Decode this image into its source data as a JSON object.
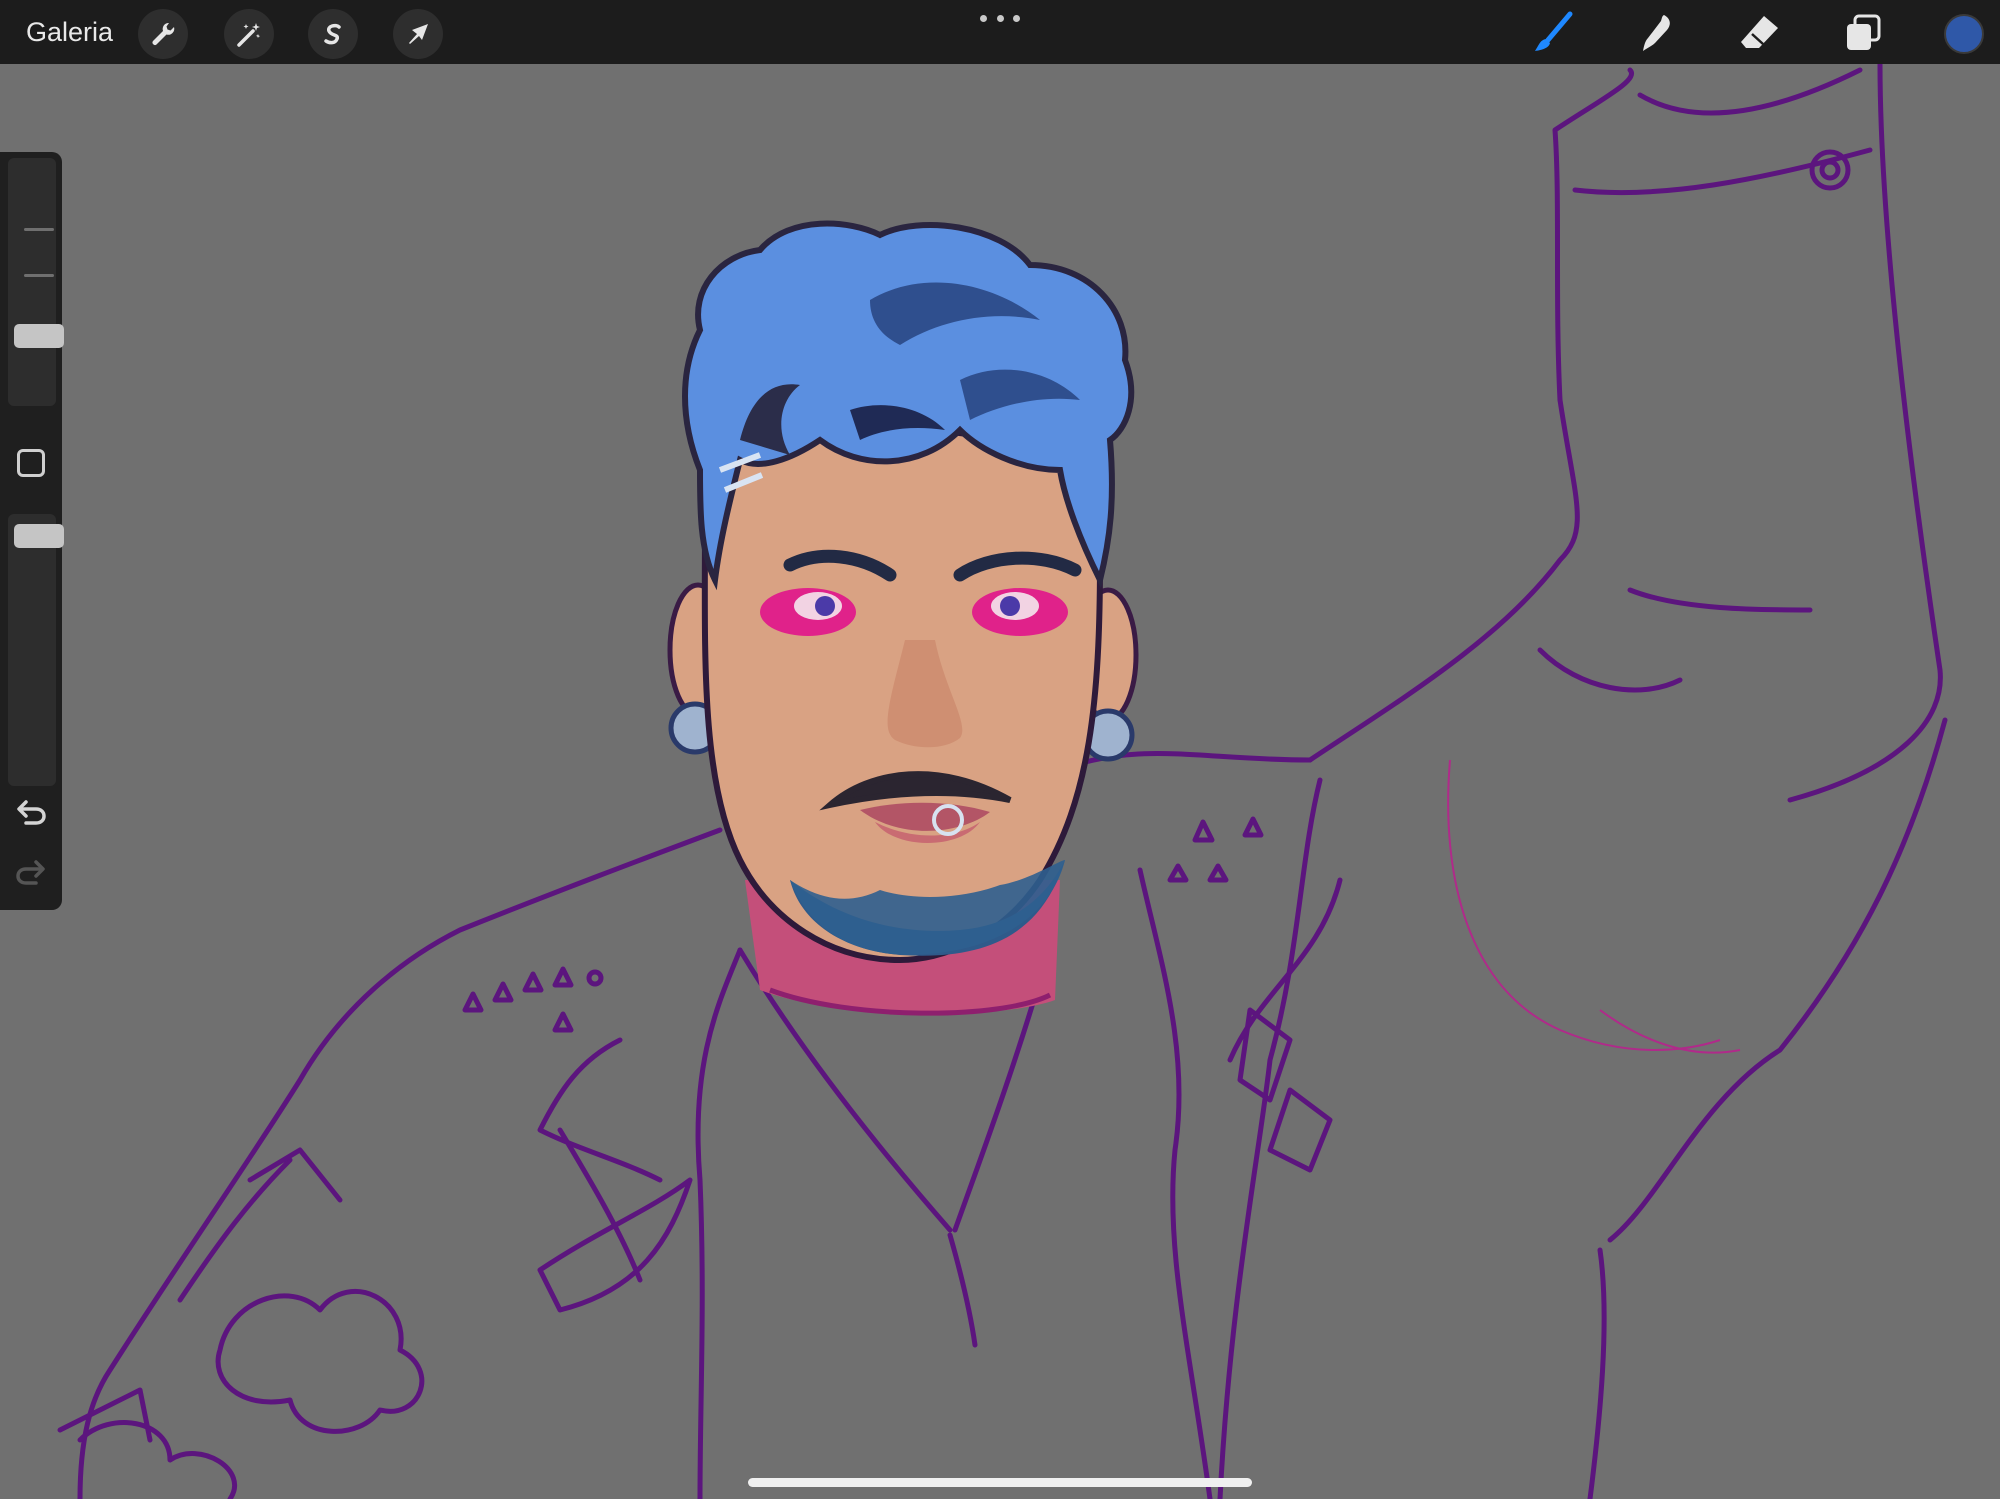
{
  "toolbar": {
    "gallery_label": "Galeria",
    "left_tools": [
      {
        "name": "actions",
        "icon": "wrench-icon"
      },
      {
        "name": "adjustments",
        "icon": "magic-wand-icon"
      },
      {
        "name": "selection",
        "icon": "selection-s-icon"
      },
      {
        "name": "transform",
        "icon": "arrow-cursor-icon"
      }
    ],
    "more_icon": "more-dots-icon",
    "right_tools": [
      {
        "name": "brush",
        "icon": "brush-icon",
        "active": true,
        "color": "#1e88ff"
      },
      {
        "name": "smudge",
        "icon": "smudge-icon",
        "active": false
      },
      {
        "name": "eraser",
        "icon": "eraser-icon",
        "active": false
      },
      {
        "name": "layers",
        "icon": "layers-icon",
        "active": false
      }
    ],
    "current_color": "#2f58a8"
  },
  "sidebar": {
    "brush_size_icon": "brush-size-slider",
    "modify_icon": "square-modify-icon",
    "opacity_icon": "opacity-slider",
    "undo_icon": "undo-icon",
    "redo_icon": "redo-icon",
    "redo_enabled": false
  },
  "canvas": {
    "background": "#707070",
    "artwork": "portrait-sketch",
    "palette": {
      "hair": "#5b8fe0",
      "hair_shadow": "#2f4f8e",
      "skin": "#d9a283",
      "eyeshadow": "#e0228a",
      "shirt_collar": "#c44f7a",
      "lineart": "#5c157e"
    }
  }
}
